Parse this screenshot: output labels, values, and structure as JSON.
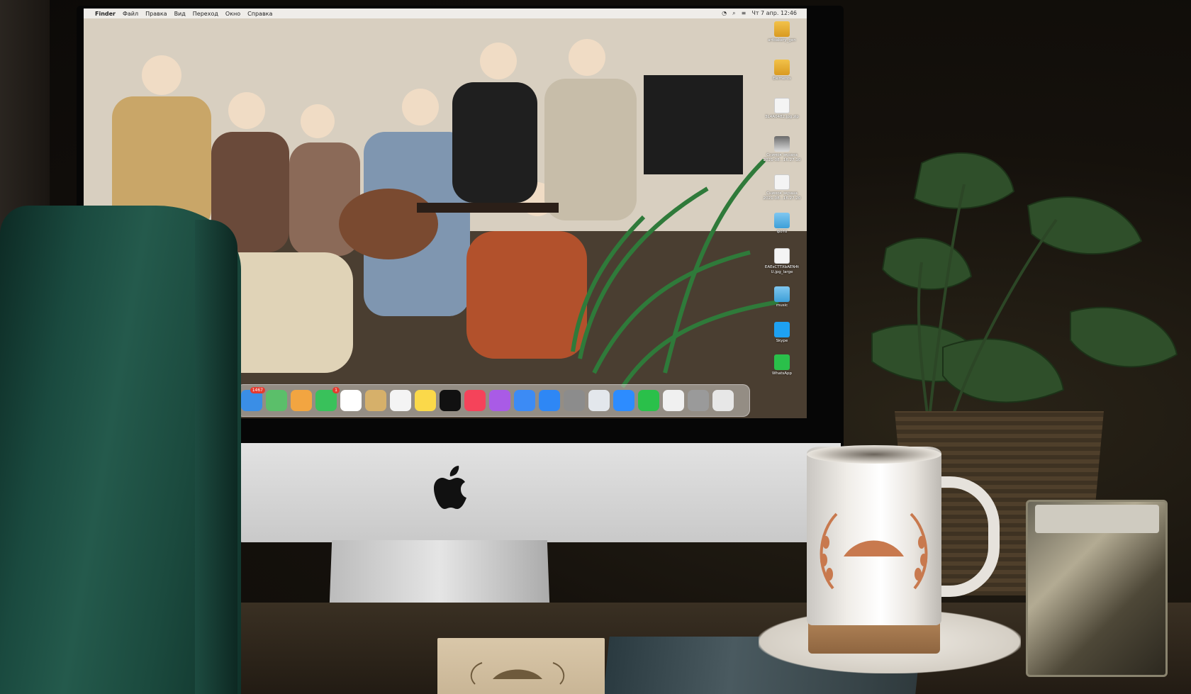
{
  "menubar": {
    "items": [
      "Finder",
      "Файл",
      "Правка",
      "Вид",
      "Переход",
      "Окно",
      "Справка"
    ],
    "clock": "Чт 7 апр. 12:46"
  },
  "desktop": {
    "icons": [
      {
        "label": "artbakery_gen",
        "kind": "folder-yellow"
      },
      {
        "label": "Elements",
        "kind": "folder-yellow"
      },
      {
        "label": "3L4A0482.jpg.zip",
        "kind": "file"
      },
      {
        "label": "Снимок экрана 2021-08...16.27.10",
        "kind": "screenshot"
      },
      {
        "label": "Снимок экрана 2021-08...16.27.20",
        "kind": "file"
      },
      {
        "label": "фото",
        "kind": "folder-blue"
      },
      {
        "label": "EAEsCTTXbAEN4t U.jpg_large",
        "kind": "file"
      },
      {
        "label": "music",
        "kind": "folder-blue"
      },
      {
        "label": "Skype",
        "kind": "skype"
      },
      {
        "label": "WhatsApp",
        "kind": "whatsapp"
      }
    ]
  },
  "dock": {
    "items": [
      {
        "name": "mail-icon",
        "color": "#3a8ee6",
        "badge": "1467"
      },
      {
        "name": "maps-icon",
        "color": "#5bbf6a",
        "badge": ""
      },
      {
        "name": "photos-icon",
        "color": "#f2a541",
        "badge": ""
      },
      {
        "name": "facetime-icon",
        "color": "#39c15b",
        "badge": "1"
      },
      {
        "name": "calendar-icon",
        "color": "#ffffff",
        "badge": ""
      },
      {
        "name": "notes-app-icon",
        "color": "#d6b06a",
        "badge": ""
      },
      {
        "name": "reminders-icon",
        "color": "#f4f4f4",
        "badge": ""
      },
      {
        "name": "notes-icon",
        "color": "#fbd94a",
        "badge": ""
      },
      {
        "name": "tv-icon",
        "color": "#111111",
        "badge": ""
      },
      {
        "name": "music-icon",
        "color": "#f5435a",
        "badge": ""
      },
      {
        "name": "podcasts-icon",
        "color": "#a95be6",
        "badge": ""
      },
      {
        "name": "keynote-icon",
        "color": "#3c8bf5",
        "badge": ""
      },
      {
        "name": "appstore-icon",
        "color": "#2e87f5",
        "badge": ""
      },
      {
        "name": "settings-icon",
        "color": "#8c8c8c",
        "badge": ""
      },
      {
        "name": "preview-icon",
        "color": "#e3e7ec",
        "badge": ""
      },
      {
        "name": "zoom-icon",
        "color": "#2d8cff",
        "badge": ""
      },
      {
        "name": "whatsapp-dock-icon",
        "color": "#2ac04a",
        "badge": ""
      },
      {
        "name": "document-icon",
        "color": "#f0f0f0",
        "badge": ""
      },
      {
        "name": "screenshot-stack-icon",
        "color": "#9a9a9a",
        "badge": ""
      },
      {
        "name": "trash-icon",
        "color": "#e7e7e7",
        "badge": ""
      }
    ]
  },
  "colors": {
    "chair": "#1f5245",
    "mug_emblem": "#c8794e",
    "plant": "#2f4f2a"
  }
}
